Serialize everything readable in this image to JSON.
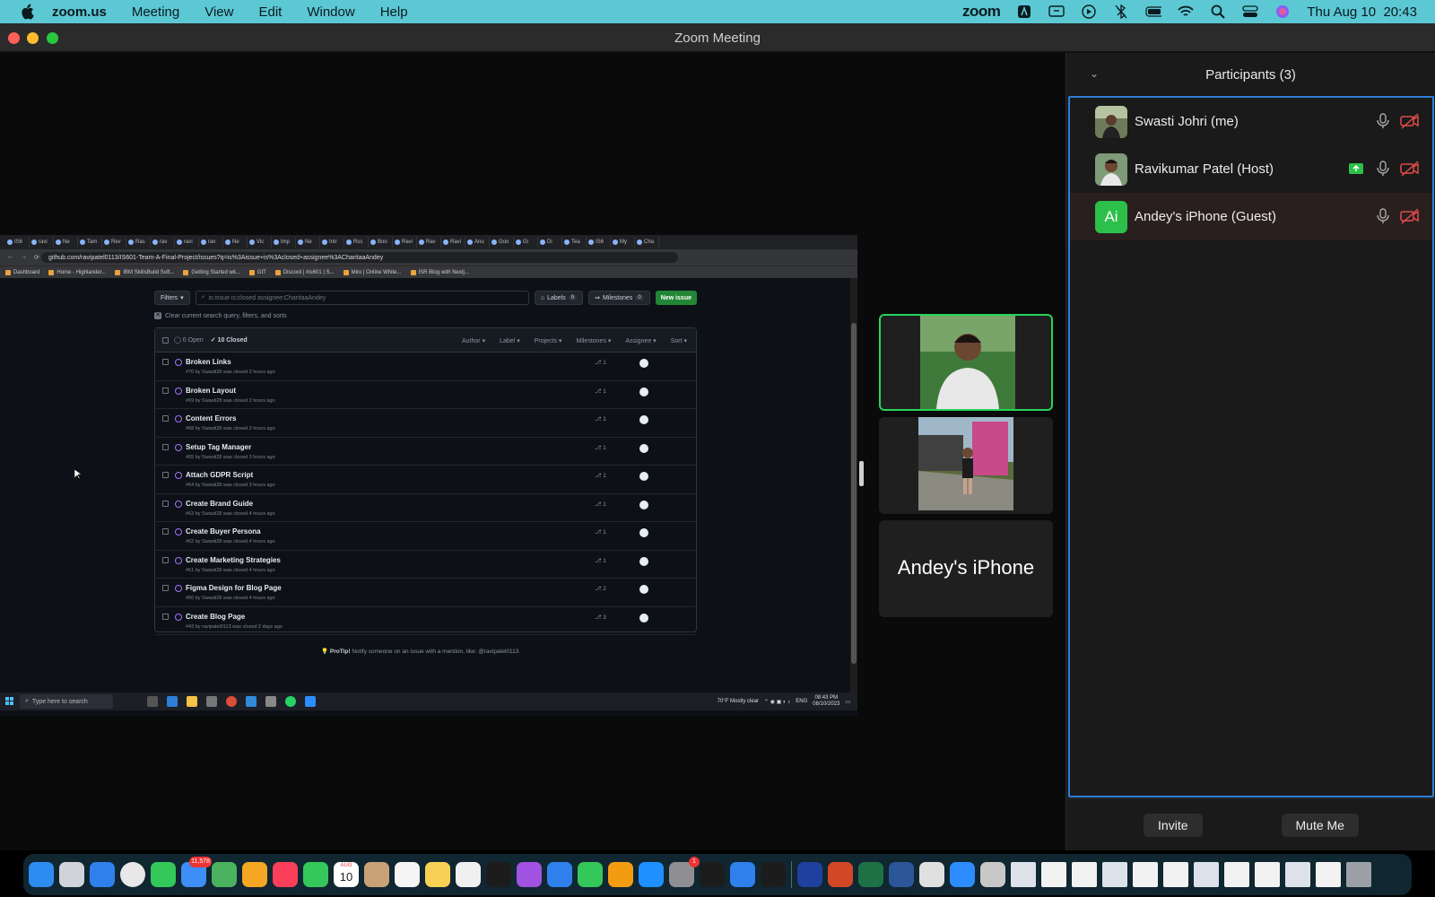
{
  "menubar": {
    "app": "zoom.us",
    "items": [
      "Meeting",
      "View",
      "Edit",
      "Window",
      "Help"
    ],
    "status_zoom": "zoom",
    "clock": "Thu Aug 10  20:43",
    "color": "#5bc8d4"
  },
  "window": {
    "title": "Zoom Meeting"
  },
  "shared_screen": {
    "browser": {
      "url": "github.com/ravipatel0113/IS601-Team-A-Final-Project/issues?q=is%3Aissue+is%3Aclosed+assignee%3ACharitaaAndey",
      "tabs": [
        "IS6",
        "ravi",
        "Ne",
        "Tam",
        "Rev",
        "Ras",
        "rav",
        "ravi",
        "rav",
        "Ne",
        "Vic",
        "Imp",
        "Ne",
        "Intr",
        "Rss",
        "Boo",
        "Ravi",
        "Rav",
        "Ravi",
        "Anu",
        "Goo",
        "Gi",
        "Di",
        "Tea",
        "IS6",
        "My",
        "Cha"
      ],
      "bookmarks": [
        "Dashboard",
        "Home - Highlander...",
        "IBM SkillsBuild Soft...",
        "Getting Started wit...",
        "GIT",
        "Discord | #is601 | S...",
        "Miro | Online White...",
        "ISR Blog with Nextj..."
      ]
    },
    "github": {
      "filters_label": "Filters",
      "search_value": "is:issue is:closed assignee:CharitaaAndey",
      "labels_label": "Labels",
      "labels_count": "9",
      "milestones_label": "Milestones",
      "milestones_count": "0",
      "new_issue_label": "New issue",
      "clear_text": "Clear current search query, filters, and sorts",
      "open_label": "0 Open",
      "closed_label": "10 Closed",
      "columns": [
        "Author",
        "Label",
        "Projects",
        "Milestones",
        "Assignee",
        "Sort"
      ],
      "issues": [
        {
          "title": "Broken Links",
          "meta": "#70 by Swasti28 was closed 2 hours ago",
          "prs": "1"
        },
        {
          "title": "Broken Layout",
          "meta": "#69 by Swasti28 was closed 2 hours ago",
          "prs": "1"
        },
        {
          "title": "Content Errors",
          "meta": "#68 by Swasti28 was closed 2 hours ago",
          "prs": "1"
        },
        {
          "title": "Setup Tag Manager",
          "meta": "#65 by Swasti28 was closed 3 hours ago",
          "prs": "1"
        },
        {
          "title": "Attach GDPR Script",
          "meta": "#64 by Swasti28 was closed 3 hours ago",
          "prs": "1"
        },
        {
          "title": "Create Brand Guide",
          "meta": "#63 by Swasti28 was closed 4 hours ago",
          "prs": "1"
        },
        {
          "title": "Create Buyer Persona",
          "meta": "#62 by Swasti28 was closed 4 hours ago",
          "prs": "1"
        },
        {
          "title": "Create Marketing Strategies",
          "meta": "#61 by Swasti28 was closed 4 hours ago",
          "prs": "1"
        },
        {
          "title": "Figma Design for Blog Page",
          "meta": "#60 by Swasti28 was closed 4 hours ago",
          "prs": "2"
        },
        {
          "title": "Create Blog Page",
          "meta": "#43 by ravipatel0113 was closed 2 days ago",
          "prs": "3"
        }
      ],
      "protip_bold": "ProTip!",
      "protip_text": " Notify someone on an issue with a mention, like: @ravipatel0113."
    },
    "taskbar": {
      "search_placeholder": "Type here to search",
      "weather": "70°F  Mostly clear",
      "lang": "ENG",
      "time": "08:43 PM",
      "date": "08/10/2023"
    }
  },
  "video_tiles": {
    "third_name": "Andey's iPhone",
    "active_color": "#27d35a"
  },
  "participants": {
    "title": "Participants (3)",
    "list": [
      {
        "name": "Swasti Johri (me)"
      },
      {
        "name": "Ravikumar Patel (Host)"
      },
      {
        "name": "Andey's iPhone (Guest)",
        "initials": "Ai"
      }
    ],
    "invite_label": "Invite",
    "mute_label": "Mute Me",
    "border_color": "#2d7ed8"
  },
  "dock": {
    "mail_badge": "11,578",
    "settings_badge": "1",
    "calendar_month": "AUG",
    "calendar_day": "10",
    "icons": [
      "finder-icon",
      "launchpad-icon",
      "safari-icon",
      "chrome-icon",
      "messages-icon",
      "mail-icon",
      "maps-icon",
      "photos-icon",
      "music-icon",
      "facetime-icon",
      "calendar-icon",
      "contacts-icon",
      "reminders-icon",
      "notes-icon",
      "freeform-icon",
      "tv-icon",
      "podcasts-icon",
      "keynote-icon",
      "numbers-icon",
      "pages-icon",
      "appstore-icon",
      "settings-icon",
      "terminal-icon",
      "vscode-icon",
      "github-icon",
      "webex-icon",
      "powerpoint-icon",
      "excel-icon",
      "word-icon",
      "preview-icon",
      "zoom-icon",
      "trash-icon"
    ]
  }
}
